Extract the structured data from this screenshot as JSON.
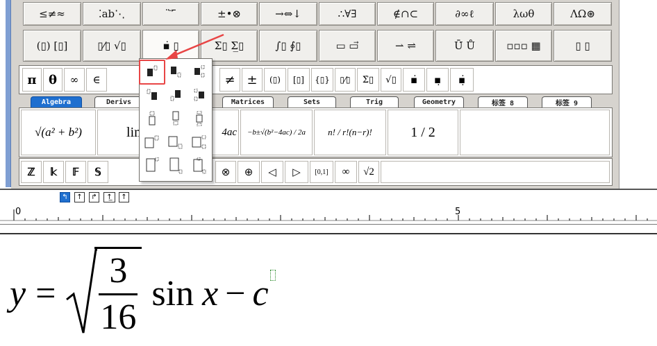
{
  "palette_row1": [
    {
      "label": "≤≠≈",
      "name": "relations-palette"
    },
    {
      "label": "⁚ab⋱",
      "name": "spaces-ellipses-palette"
    },
    {
      "label": "¨ ⃗ ̄",
      "name": "embellishments-palette"
    },
    {
      "label": "±•⊗",
      "name": "operators-palette"
    },
    {
      "label": "→⇔↓",
      "name": "arrows-palette"
    },
    {
      "label": "∴∀∃",
      "name": "logic-palette"
    },
    {
      "label": "∉∩⊂",
      "name": "set-theory-palette"
    },
    {
      "label": "∂∞ℓ",
      "name": "misc-symbols-palette"
    },
    {
      "label": "λωθ",
      "name": "greek-lower-palette"
    },
    {
      "label": "ΛΩ⊛",
      "name": "greek-upper-palette"
    }
  ],
  "palette_row2": [
    {
      "label": "(▯) [▯]",
      "name": "fences-palette"
    },
    {
      "label": "▯⁄▯ √▯",
      "name": "fractions-radicals-palette"
    },
    {
      "label": "▪̇ ▯̣",
      "name": "scripts-palette"
    },
    {
      "label": "Σ▯ Σ̲▯",
      "name": "summation-palette"
    },
    {
      "label": "∫▯ ∮▯",
      "name": "integrals-palette"
    },
    {
      "label": "▭ ▭⃗",
      "name": "underbar-overbar-palette"
    },
    {
      "label": "⇀ ⇌",
      "name": "labeled-arrows-palette"
    },
    {
      "label": "Ū̇ Ů",
      "name": "products-palette"
    },
    {
      "label": "▫▫▫ ▦",
      "name": "matrices-palette"
    },
    {
      "label": "▯ ▯",
      "name": "boxes-palette"
    }
  ],
  "template_row": [
    {
      "label": "π",
      "name": "pi-template"
    },
    {
      "label": "θ",
      "name": "theta-template"
    },
    {
      "label": "∞",
      "name": "infinity-template"
    },
    {
      "label": "∈",
      "name": "element-of-template"
    },
    {
      "label": "≠",
      "name": "not-equal-template"
    },
    {
      "label": "±",
      "name": "plus-minus-template"
    },
    {
      "label": "(▯)",
      "name": "parentheses-template"
    },
    {
      "label": "[▯]",
      "name": "brackets-template"
    },
    {
      "label": "{▯}",
      "name": "braces-template"
    },
    {
      "label": "▯⁄▯",
      "name": "fraction-template"
    },
    {
      "label": "Σ̇▯",
      "name": "sum-template"
    },
    {
      "label": "√▯",
      "name": "sqrt-template"
    },
    {
      "label": "▪̇",
      "name": "superscript-template"
    },
    {
      "label": "▪̣",
      "name": "subscript-template"
    },
    {
      "label": "▪̣̇",
      "name": "sub-superscript-template"
    }
  ],
  "tabs": [
    "Algebra",
    "Derivs",
    "Matrices",
    "Sets",
    "Trig",
    "Geometry",
    "标签 8",
    "标签 9"
  ],
  "expressions": [
    {
      "label": "√(a² + b²)",
      "name": "expr-pythagoras"
    },
    {
      "label": "lim x→∞",
      "name": "expr-limit"
    },
    {
      "label": "4ac",
      "name": "expr-discriminant"
    },
    {
      "label": "−b±√(b²−4ac) / 2a",
      "name": "expr-quadratic"
    },
    {
      "label": "n! / r!(n−r)!",
      "name": "expr-combination"
    },
    {
      "label": "1 / 2",
      "name": "expr-half"
    }
  ],
  "symbols": [
    {
      "label": "ℤ",
      "name": "integers-symbol"
    },
    {
      "label": "𝕜",
      "name": "k-symbol"
    },
    {
      "label": "𝔽",
      "name": "field-symbol"
    },
    {
      "label": "𝕊",
      "name": "s-symbol"
    },
    {
      "label": "⊗",
      "name": "tensor-product-symbol"
    },
    {
      "label": "⊕",
      "name": "direct-sum-symbol"
    },
    {
      "label": "◁",
      "name": "normal-subgroup-symbol"
    },
    {
      "label": "▷",
      "name": "contains-normal-symbol"
    },
    {
      "label": "[0,1]",
      "name": "interval-symbol"
    },
    {
      "label": "∞",
      "name": "infinity-symbol"
    },
    {
      "label": "√2",
      "name": "sqrt2-symbol"
    }
  ],
  "level_buttons": [
    "↰",
    "↑",
    "↱",
    "↑̲",
    "↑"
  ],
  "ruler": {
    "start": "0",
    "mid": "5"
  },
  "equation": {
    "lhs": "y",
    "eq": "=",
    "num": "3",
    "den": "16",
    "fn": "sin",
    "var": "x",
    "minus": "−",
    "c": "c"
  },
  "colors": {
    "accent": "#1f6fcf",
    "highlight": "#e84545",
    "panel": "#d6d3ce",
    "cursor": "#2a8a2a"
  }
}
